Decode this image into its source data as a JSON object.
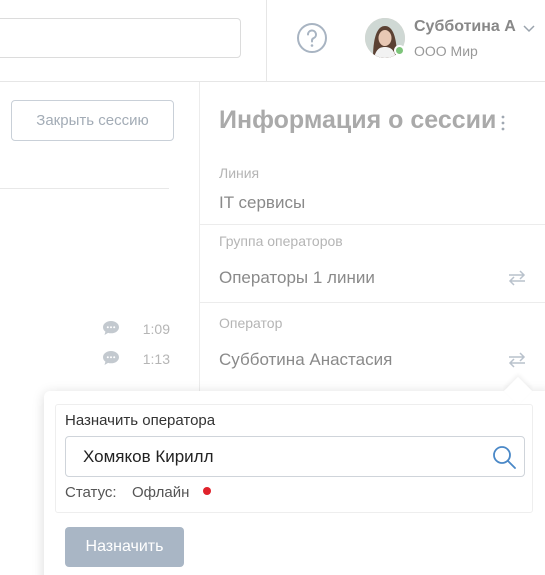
{
  "header": {
    "user_name": "Субботина А",
    "user_org": "ООО Мир"
  },
  "session": {
    "close_label": "Закрыть сессию",
    "chat_times": [
      "1:09",
      "1:13"
    ]
  },
  "info_panel": {
    "title": "Информация о сессии",
    "line_label": "Линия",
    "line_value": "IT сервисы",
    "group_label": "Группа операторов",
    "group_value": "Операторы 1 линии",
    "operator_label": "Оператор",
    "operator_value": "Субботина Анастасия"
  },
  "assign_popover": {
    "title": "Назначить оператора",
    "input_value": "Хомяков Кирилл",
    "status_label": "Статус:",
    "status_value": "Офлайн",
    "status_color": "#e0222b",
    "assign_label": "Назначить"
  },
  "icons": [
    "help-icon",
    "chevron-down-icon",
    "chat-bubble-icon",
    "more-vertical-icon",
    "swap-icon",
    "search-icon"
  ]
}
